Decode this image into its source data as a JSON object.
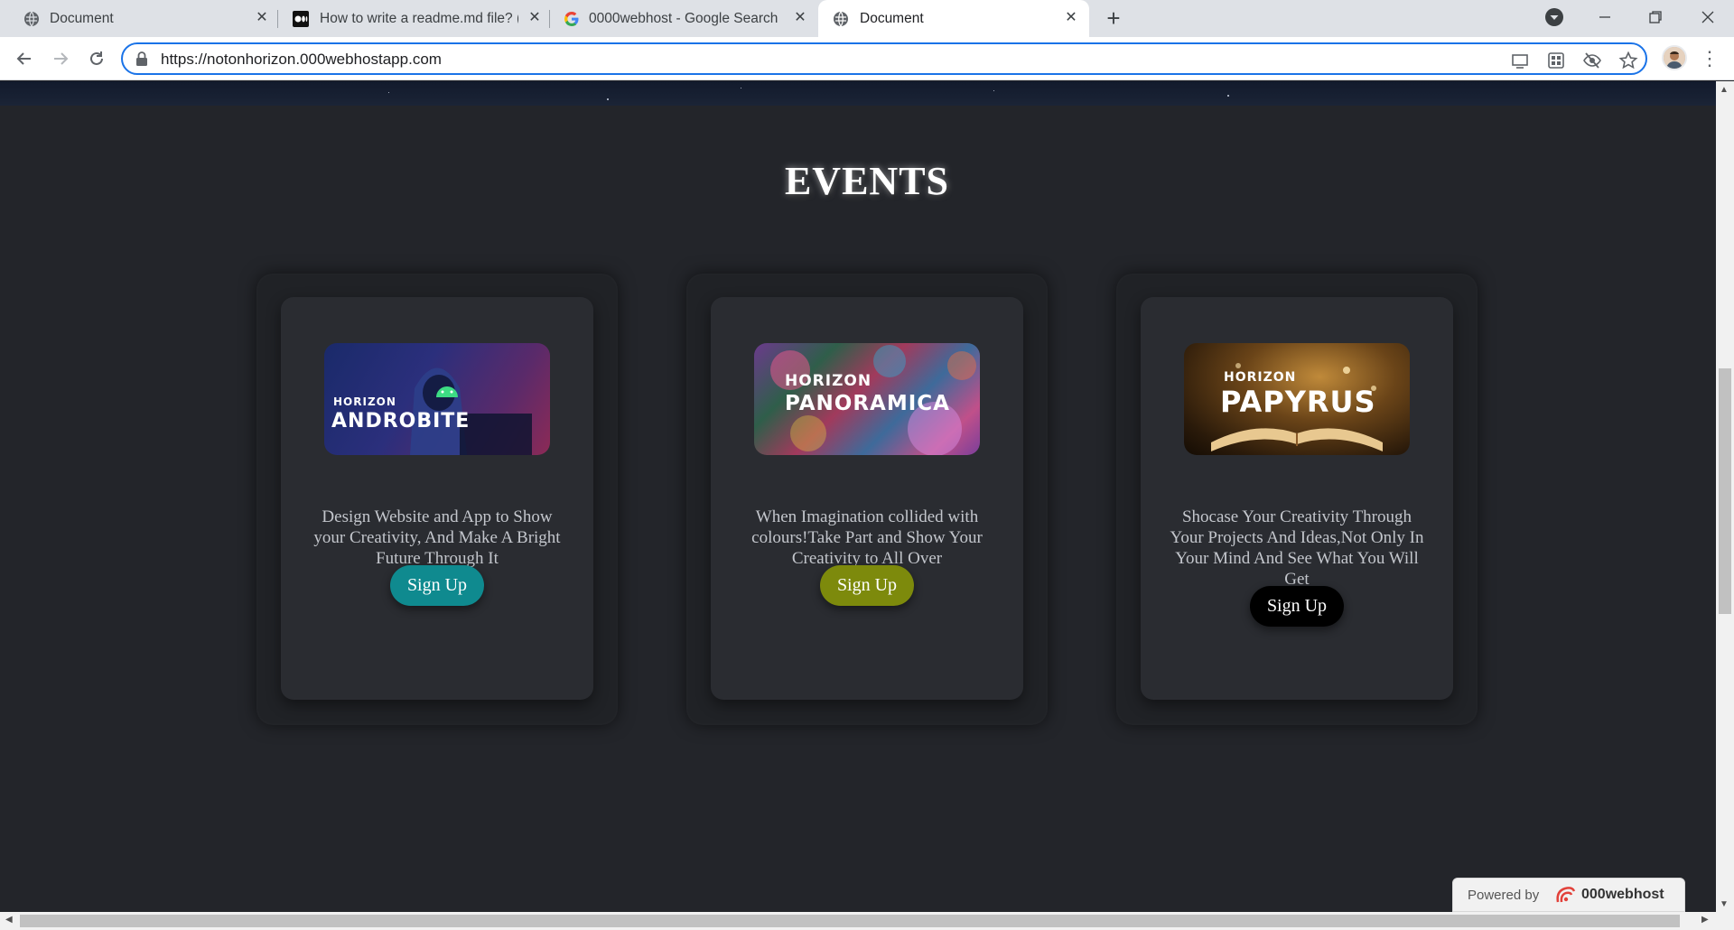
{
  "browser": {
    "tabs": [
      {
        "title": "Document",
        "favicon": "globe-icon",
        "active": false
      },
      {
        "title": "How to write a readme.md file? (",
        "favicon": "medium-icon",
        "active": false
      },
      {
        "title": "0000webhost - Google Search",
        "favicon": "google-icon",
        "active": false
      },
      {
        "title": "Document",
        "favicon": "globe-icon",
        "active": true
      }
    ],
    "url": "https://notonhorizon.000webhostapp.com"
  },
  "page": {
    "section_title": "EVENTS",
    "events": [
      {
        "banner_brand": "HORIZON",
        "banner_title": "ANDROBITE",
        "description": "Design Website and App to Show your Creativity, And Make A Bright Future Through It",
        "button_label": "Sign Up",
        "button_color": "#0f8a8f"
      },
      {
        "banner_brand": "HORIZON",
        "banner_title": "PANORAMICA",
        "description": "When Imagination collided with colours!Take Part and Show Your Creativity to All Over",
        "button_label": "Sign Up",
        "button_color": "#7d8a0c"
      },
      {
        "banner_brand": "HORIZON",
        "banner_title": "PAPYRUS",
        "description": "Shocase Your Creativity Through Your Projects And Ideas,Not Only In Your Mind And See What You Will Get",
        "button_label": "Sign Up",
        "button_color": "#000000"
      }
    ],
    "powered_by": {
      "label": "Powered by",
      "brand": "000webhost"
    }
  },
  "colors": {
    "page_bg": "#23252a",
    "card_outer": "#202226",
    "card_inner": "#2a2c31",
    "omnibox_focus": "#1a73e8"
  }
}
